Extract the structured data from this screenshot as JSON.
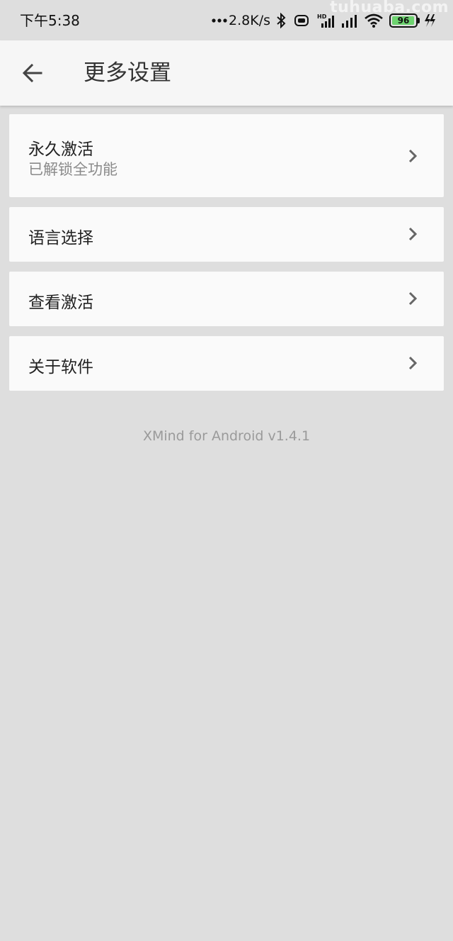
{
  "status_bar": {
    "time": "下午5:38",
    "network_speed": "2.8K/s",
    "battery_level": "96",
    "watermark": "tuhuaba.com"
  },
  "header": {
    "title": "更多设置"
  },
  "settings": {
    "items": [
      {
        "label": "永久激活",
        "sublabel": "已解锁全功能"
      },
      {
        "label": "语言选择"
      },
      {
        "label": "查看激活"
      },
      {
        "label": "关于软件"
      }
    ]
  },
  "footer": {
    "version": "XMind for Android v1.4.1"
  },
  "colors": {
    "background": "#dedede",
    "card": "#fafafa",
    "appbar": "#f6f6f6",
    "battery_fill": "#6dd36f"
  }
}
